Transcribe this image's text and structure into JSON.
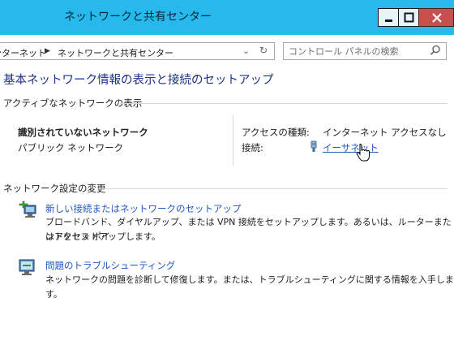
{
  "window": {
    "title": "ネットワークと共有センター"
  },
  "address": {
    "crumbs": [
      "ンターネット",
      "ネットワークと共有センター"
    ]
  },
  "search": {
    "placeholder": "コントロール パネルの検索"
  },
  "main_title": "基本ネットワーク情報の表示と接続のセットアップ",
  "active_networks": {
    "heading": "アクティブなネットワークの表示",
    "network_name": "識別されていないネットワーク",
    "network_type": "パブリック ネットワーク",
    "access_type_label": "アクセスの種類:",
    "access_type_value": "インターネット アクセスなし",
    "connections_label": "接続:",
    "connection_link": "イーサネット"
  },
  "change_settings": {
    "heading": "ネットワーク設定の変更",
    "tasks": [
      {
        "link": "新しい接続またはネットワークのセットアップ",
        "desc_line1": "ブロードバンド、ダイヤルアップ、または VPN 接続をセットアップします。あるいは、ルーターまたはアクセス ポイ",
        "desc_line2": "ントをセットアップします。",
        "icon": "network-setup-icon"
      },
      {
        "link": "問題のトラブルシューティング",
        "desc_line1": "ネットワークの問題を診断して修復します。または、トラブルシューティングに関する情報を入手します。",
        "icon": "troubleshoot-icon"
      }
    ]
  },
  "colors": {
    "titlebar": "#27b9ec",
    "heading": "#1e3287",
    "link": "#1e58c6",
    "close_button": "#c7504c"
  }
}
